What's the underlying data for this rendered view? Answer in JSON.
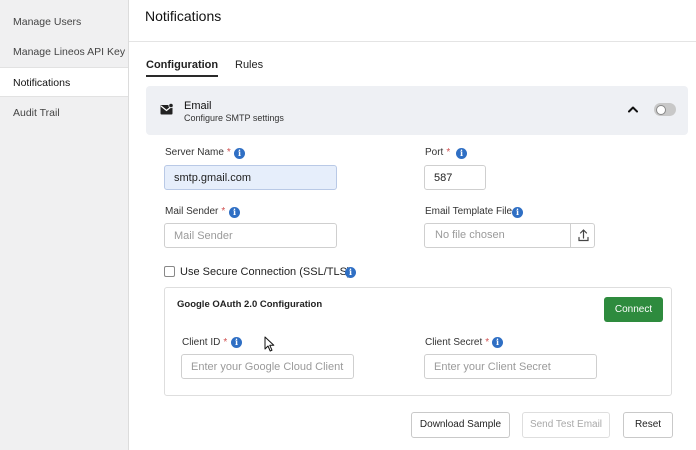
{
  "sidebar": {
    "items": [
      {
        "label": "Manage Users"
      },
      {
        "label": "Manage Lineos API Key"
      },
      {
        "label": "Notifications"
      },
      {
        "label": "Audit Trail"
      }
    ]
  },
  "header": {
    "title": "Notifications"
  },
  "tabs": [
    {
      "label": "Configuration",
      "active": true
    },
    {
      "label": "Rules",
      "active": false
    }
  ],
  "email_section": {
    "title": "Email",
    "subtitle": "Configure SMTP settings",
    "expanded": true,
    "enabled": false,
    "icon": "mail-icon"
  },
  "form": {
    "server_name": {
      "label": "Server Name",
      "required_mark": "*",
      "value": "smtp.gmail.com"
    },
    "port": {
      "label": "Port",
      "required_mark": "*",
      "value": "587"
    },
    "mail_sender": {
      "label": "Mail Sender",
      "required_mark": "*",
      "placeholder": "Mail Sender"
    },
    "template_file": {
      "label": "Email Template File",
      "text": "No file chosen"
    },
    "secure_connection": {
      "label": "Use Secure Connection (SSL/TLS)",
      "checked": false
    }
  },
  "oauth": {
    "title": "Google OAuth 2.0 Configuration",
    "connect_label": "Connect",
    "client_id": {
      "label": "Client ID",
      "required_mark": "*",
      "placeholder": "Enter your Google Cloud Client"
    },
    "client_secret": {
      "label": "Client Secret",
      "required_mark": "*",
      "placeholder": "Enter your Client Secret"
    }
  },
  "actions": {
    "download_sample": "Download Sample",
    "send_test_email": "Send Test Email",
    "reset": "Reset"
  },
  "colors": {
    "connect_bg": "#2e8b3e",
    "info_icon": "#2f6fc4",
    "required": "#d05050",
    "email_header_bg": "#eef0f4",
    "filled_input_bg": "#e6eefb"
  }
}
